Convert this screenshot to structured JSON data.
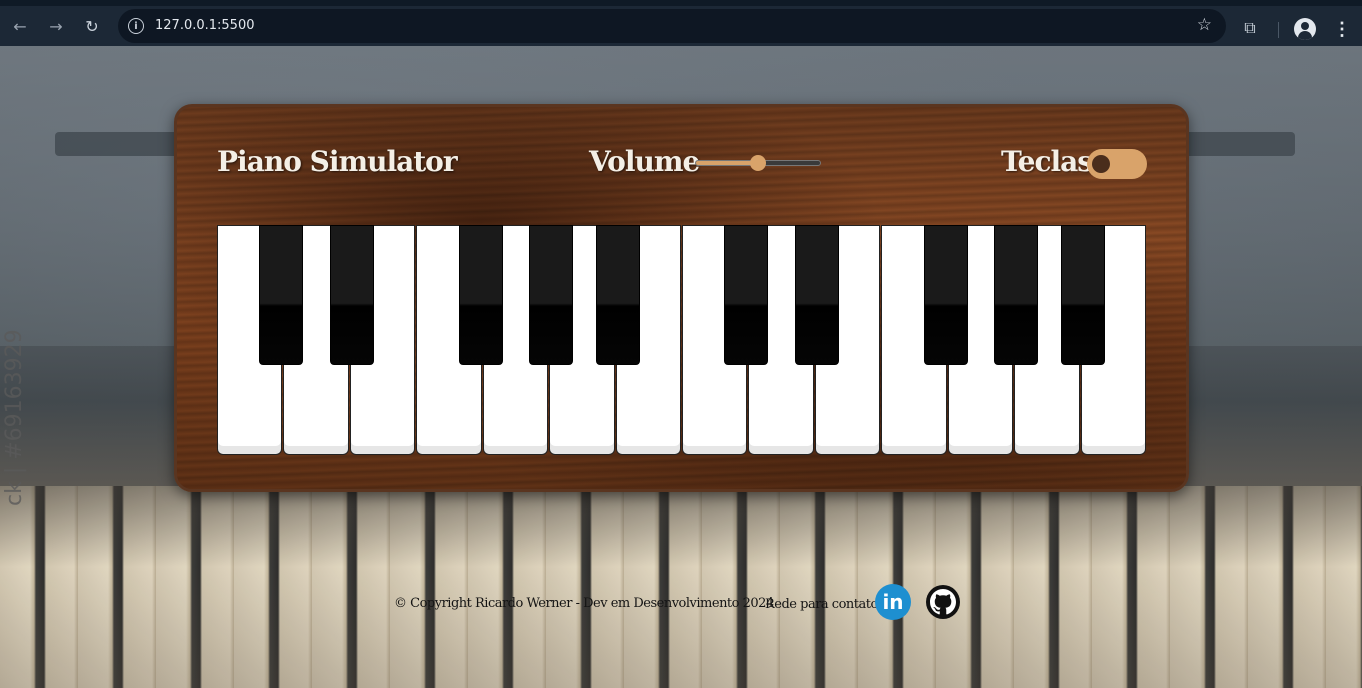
{
  "browser": {
    "url": "127.0.0.1:5500"
  },
  "app": {
    "title": "Piano Simulator",
    "volume_label": "Volume",
    "volume_level": 0.5,
    "keys_label": "Teclas",
    "keys_toggle_on": false
  },
  "keyboard": {
    "white_keys": 14,
    "black_key_positions": [
      0,
      1,
      3,
      4,
      5,
      7,
      8,
      10,
      11,
      12
    ]
  },
  "footer": {
    "copyright": "© Copyright  Ricardo Werner - Dev em Desenvolvimento  2024",
    "contacts_label": "Rede para contatos",
    "linkedin_glyph": "in"
  },
  "watermark": "ck | #69163929",
  "colors": {
    "accent": "#d9a36a",
    "linkedin": "#1e8fd0"
  }
}
